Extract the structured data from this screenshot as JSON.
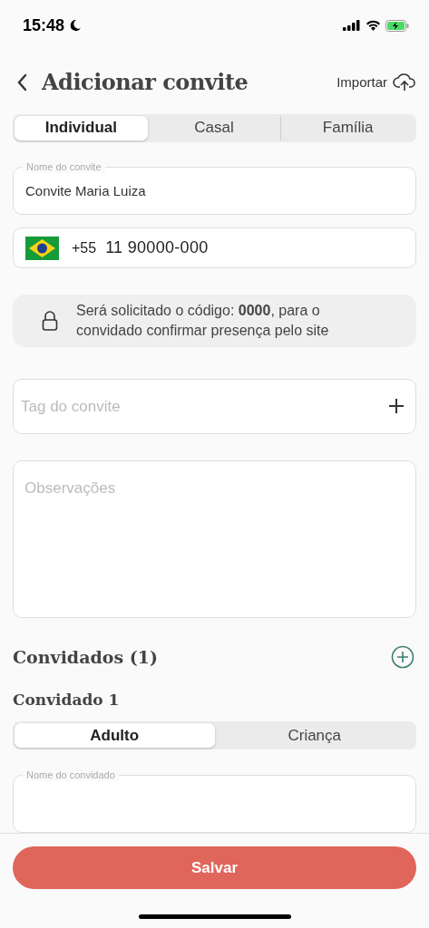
{
  "status_bar": {
    "time": "15:48"
  },
  "header": {
    "title": "Adicionar convite",
    "action": "Importar"
  },
  "invite_type_tabs": [
    {
      "label": "Individual",
      "selected": true
    },
    {
      "label": "Casal",
      "selected": false
    },
    {
      "label": "Família",
      "selected": false
    }
  ],
  "invite_name": {
    "label": "Nome do convite",
    "value": "Convite Maria Luiza"
  },
  "phone": {
    "country_code": "+55",
    "value": "11 90000-000"
  },
  "code_notice": "Será solicitado o código: **0000**, para o convidado confirmar presença pelo site",
  "tag": {
    "placeholder": "Tag do convite"
  },
  "notes": {
    "placeholder": "Observações"
  },
  "guests_section": {
    "title": "Convidados (1)"
  },
  "guests": [
    {
      "title": "Convidado 1",
      "age_tabs": [
        {
          "label": "Adulto",
          "selected": true
        },
        {
          "label": "Criança",
          "selected": false
        }
      ],
      "name_label": "Nome do convidado"
    }
  ],
  "save_button": "Salvar"
}
